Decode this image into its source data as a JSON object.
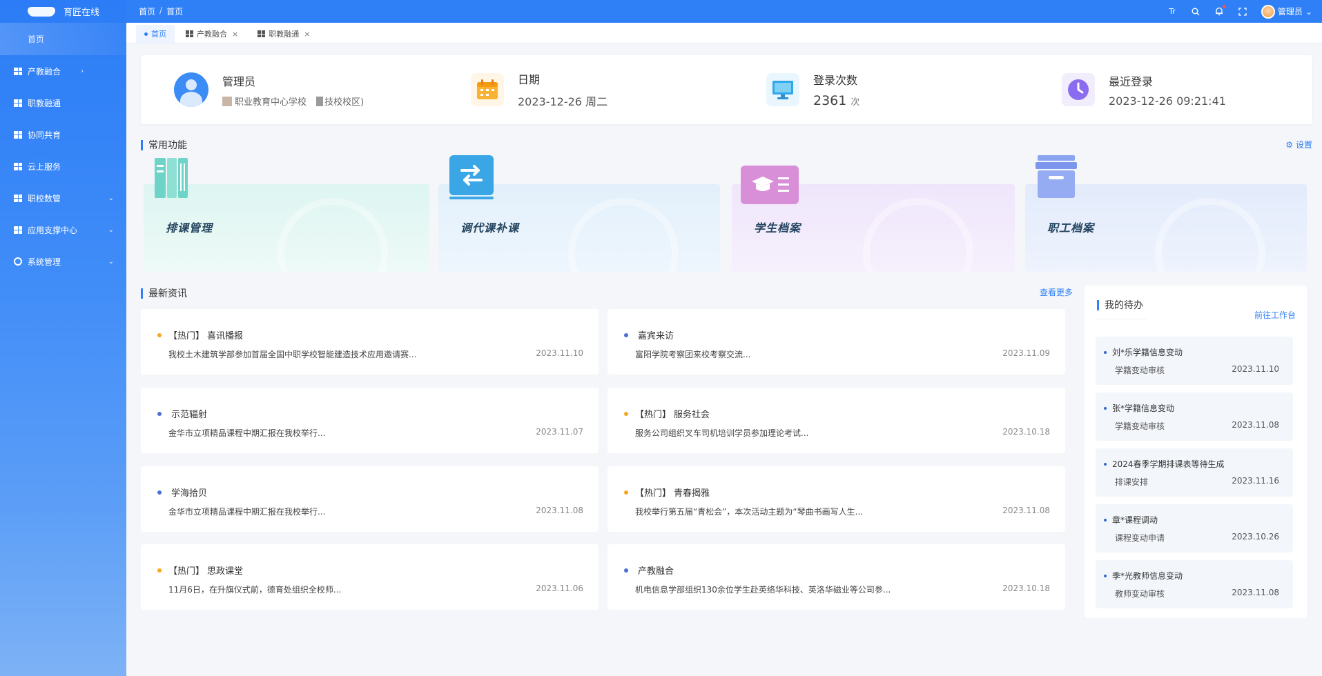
{
  "app": {
    "logo_text": "育匠在线"
  },
  "sidebar": {
    "home_label": "首页",
    "items": [
      {
        "label": "产教融合",
        "chevron": "›"
      },
      {
        "label": "职教融通",
        "chevron": ""
      },
      {
        "label": "协同共育",
        "chevron": ""
      },
      {
        "label": "云上服务",
        "chevron": ""
      },
      {
        "label": "职校数管",
        "chevron": "⌄"
      },
      {
        "label": "应用支撑中心",
        "chevron": "⌄"
      },
      {
        "label": "系统管理",
        "chevron": "⌄"
      }
    ]
  },
  "topbar": {
    "crumb_1": "首页",
    "crumb_sep": "/",
    "crumb_2": "首页",
    "font_icon": "Tr",
    "user_name": "管理员",
    "user_chevron": "⌄"
  },
  "tabs": [
    {
      "label": "首页"
    },
    {
      "label": "产教融合",
      "close": "×"
    },
    {
      "label": "职教融通",
      "close": "×"
    }
  ],
  "profile": {
    "name": "管理员",
    "school": "职业教育中心学校",
    "campus": "技校校区)",
    "date_label": "日期",
    "date_value": "2023-12-26 周二",
    "login_label": "登录次数",
    "login_count": "2361",
    "login_unit": "次",
    "last_label": "最近登录",
    "last_value": "2023-12-26 09:21:41"
  },
  "features": {
    "title": "常用功能",
    "settings_label": "设置",
    "items": [
      {
        "label": "排课管理",
        "color": "#e3f7f3"
      },
      {
        "label": "调代课补课",
        "color": "#e4f0fc"
      },
      {
        "label": "学生档案",
        "color": "#f1ebfc"
      },
      {
        "label": "职工档案",
        "color": "#e7eefc"
      }
    ]
  },
  "news": {
    "title": "最新资讯",
    "more_label": "查看更多",
    "items": [
      {
        "tag": "【热门】",
        "title": "喜讯播报",
        "desc": "我校土木建筑学部参加首届全国中职学校智能建造技术应用邀请赛...",
        "date": "2023.11.10",
        "dot": "#f5a623"
      },
      {
        "tag": "",
        "title": "嘉宾来访",
        "desc": "富阳学院考察团来校考察交流...",
        "date": "2023.11.09",
        "dot": "#4a6fd8"
      },
      {
        "tag": "",
        "title": "示范辐射",
        "desc": "金华市立项精品课程中期汇报在我校举行...",
        "date": "2023.11.07",
        "dot": "#4a6fd8"
      },
      {
        "tag": "【热门】",
        "title": "服务社会",
        "desc": "服务公司组织叉车司机培训学员参加理论考试...",
        "date": "2023.10.18",
        "dot": "#f5a623"
      },
      {
        "tag": "",
        "title": "学海拾贝",
        "desc": "金华市立项精品课程中期汇报在我校举行...",
        "date": "2023.11.08",
        "dot": "#4a6fd8"
      },
      {
        "tag": "【热门】",
        "title": "青春揭雅",
        "desc": "我校举行第五届“青松会”，本次活动主题为“琴曲书画写人生...",
        "date": "2023.11.08",
        "dot": "#f5a623"
      },
      {
        "tag": "【热门】",
        "title": "思政课堂",
        "desc": "11月6日，在升旗仪式前，德育处组织全校师...",
        "date": "2023.11.06",
        "dot": "#f5a623"
      },
      {
        "tag": "",
        "title": "产教融合",
        "desc": "机电信息学部组织130余位学生赴英络华科技、英洛华磁业等公司参...",
        "date": "2023.10.18",
        "dot": "#4a6fd8"
      }
    ]
  },
  "todo": {
    "title": "我的待办",
    "link_label": "前往工作台",
    "items": [
      {
        "title": "刘*乐学籍信息变动",
        "sub": "学籍变动审核",
        "date": "2023.11.10"
      },
      {
        "title": "张*学籍信息变动",
        "sub": "学籍变动审核",
        "date": "2023.11.08"
      },
      {
        "title": "2024春季学期排课表等待生成",
        "sub": "排课安排",
        "date": "2023.11.16"
      },
      {
        "title": "章*课程调动",
        "sub": "课程变动申请",
        "date": "2023.10.26"
      },
      {
        "title": "季*光教师信息变动",
        "sub": "教师变动审核",
        "date": "2023.11.08"
      }
    ]
  }
}
